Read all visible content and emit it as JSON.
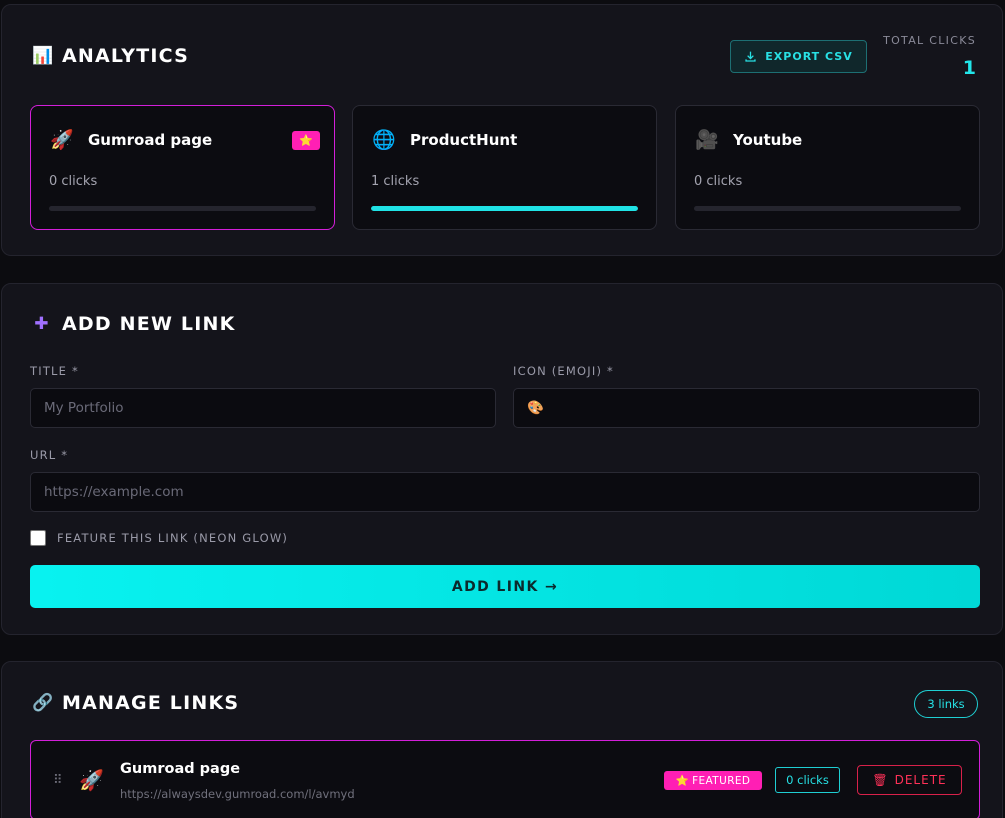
{
  "analytics": {
    "icon": "📊",
    "title": "ANALYTICS",
    "export_label": "EXPORT CSV",
    "total_label": "TOTAL CLICKS",
    "total_value": "1",
    "cards": [
      {
        "emoji": "🚀",
        "title": "Gumroad page",
        "clicks": "0 clicks",
        "featured": true,
        "star": "⭐",
        "progress": 0
      },
      {
        "emoji": "🌐",
        "title": "ProductHunt",
        "clicks": "1 clicks",
        "featured": false,
        "progress": 1
      },
      {
        "emoji": "🎥",
        "title": "Youtube",
        "clicks": "0 clicks",
        "featured": false,
        "progress": 0
      }
    ]
  },
  "add_link": {
    "icon": "➕",
    "title": "ADD NEW LINK",
    "title_label": "TITLE *",
    "title_placeholder": "My Portfolio",
    "icon_label": "ICON (EMOJI) *",
    "icon_placeholder": "🎨",
    "url_label": "URL *",
    "url_placeholder": "https://example.com",
    "feature_label": "FEATURE THIS LINK (NEON GLOW)",
    "feature_checked": false,
    "submit_label": "ADD LINK →"
  },
  "manage": {
    "icon": "🔗",
    "title": "MANAGE LINKS",
    "count_label": "3 links",
    "links": [
      {
        "drag": "⠿",
        "emoji": "🚀",
        "title": "Gumroad page",
        "url": "https://alwaysdev.gumroad.com/l/avmyd",
        "featured_label": "FEATURED",
        "featured_star": "⭐",
        "clicks": "0 clicks",
        "delete_icon": "🗑",
        "delete_label": "DELETE"
      }
    ]
  },
  "colors": {
    "accent_cyan": "#20e3e6",
    "accent_pink": "#ff1fb4",
    "danger": "#ff3158"
  }
}
